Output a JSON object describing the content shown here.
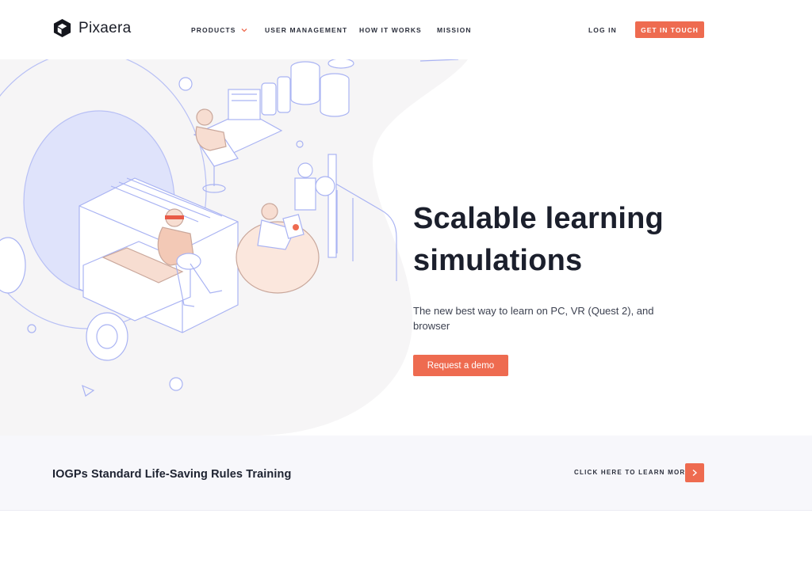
{
  "brand": {
    "name": "Pixaera"
  },
  "nav": {
    "products": "PRODUCTS",
    "user_management": "USER MANAGEMENT",
    "how_it_works": "HOW IT WORKS",
    "mission": "MISSION",
    "login": "LOG IN",
    "cta": "GET IN TOUCH"
  },
  "hero": {
    "title_line1": "Scalable learning",
    "title_line2": "simulations",
    "subtitle": "The new best way to learn on PC, VR (Quest 2), and browser",
    "cta": "Request a demo"
  },
  "banner": {
    "title": "IOGPs Standard Life-Saving Rules Training",
    "link": "CLICK HERE TO LEARN MORE"
  },
  "icons": {
    "logo": "pixaera-logo-icon",
    "chevron": "chevron-down-icon",
    "arrow": "chevron-right-icon"
  },
  "colors": {
    "accent": "#ee6b50",
    "hero_bg": "#f6f5f6",
    "illustration_line": "#a9b3f3",
    "illustration_fill": "#f7ddd1",
    "text_dark": "#1b1f2c",
    "banner_bg": "#f7f7fb"
  }
}
